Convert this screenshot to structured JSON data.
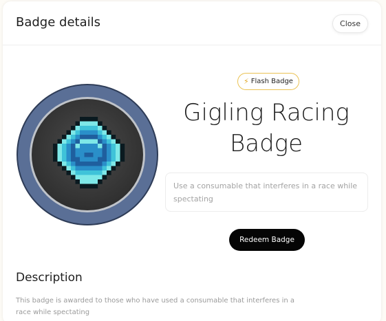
{
  "modal": {
    "title": "Badge details",
    "close_label": "Close"
  },
  "badge": {
    "type_label": "Flash Badge",
    "type_icon": "lightning-bolt-icon",
    "name": "Gigling Racing Badge",
    "requirement": "Use a consumable that interferes in a race while spectating",
    "redeem_label": "Redeem Badge",
    "art_icon": "pixel-gem-icon"
  },
  "description": {
    "heading": "Description",
    "text": "This badge is awarded to those who have used a consumable that interferes in a race while spectating"
  },
  "colors": {
    "ring": "#5a6f96",
    "ring_inner": "#3d3d3d",
    "gem_light": "#7ee8e8",
    "gem_mid": "#2a8fc9",
    "pill_border": "#eac253",
    "button": "#050505"
  }
}
